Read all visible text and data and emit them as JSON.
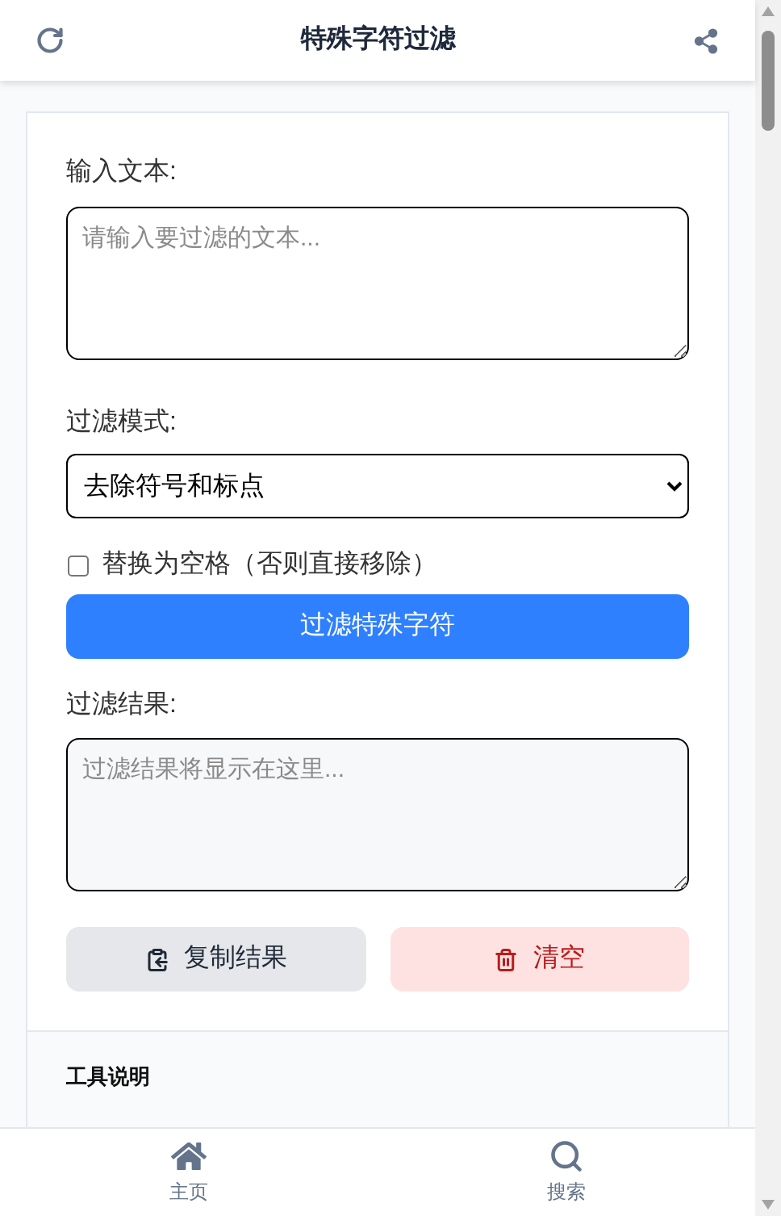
{
  "header": {
    "title": "特殊字符过滤"
  },
  "input": {
    "label": "输入文本:",
    "placeholder": "请输入要过滤的文本..."
  },
  "filter_mode": {
    "label": "过滤模式:",
    "value": "去除符号和标点"
  },
  "replace_option": {
    "label": "替换为空格（否则直接移除）",
    "checked": false
  },
  "filter_button": "过滤特殊字符",
  "result": {
    "label": "过滤结果:",
    "placeholder": "过滤结果将显示在这里..."
  },
  "copy_button": "复制结果",
  "clear_button": "清空",
  "info": {
    "title": "工具说明"
  },
  "nav": [
    {
      "kind": "home",
      "label": "主页",
      "selected": false
    },
    {
      "kind": "search",
      "label": "搜索",
      "selected": false
    }
  ]
}
